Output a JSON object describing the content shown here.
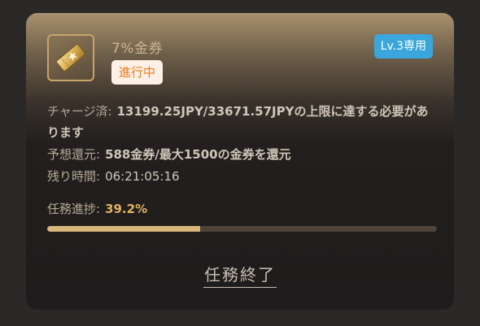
{
  "task": {
    "title": "7%金券",
    "status": "進行中",
    "level_badge": "Lv.3専用",
    "icon": "golden-ticket-icon"
  },
  "details": {
    "condition_label": "チャージ済:",
    "condition_value": "13199.25JPY/33671.57JPYの上限に達する必要があります",
    "reward_label": "予想還元:",
    "reward_value": "588金券/最大1500の金券を還元",
    "remaining_label": "残り時間:",
    "remaining_value": "06:21:05:16"
  },
  "progress": {
    "label": "任務進捗:",
    "percent_text": "39.2%",
    "fraction": 0.392
  },
  "actions": {
    "end_label": "任務終了"
  },
  "colors": {
    "accent_gold": "#e0b25c",
    "badge_blue": "#3aa6db",
    "status_orange": "#e67e22"
  }
}
